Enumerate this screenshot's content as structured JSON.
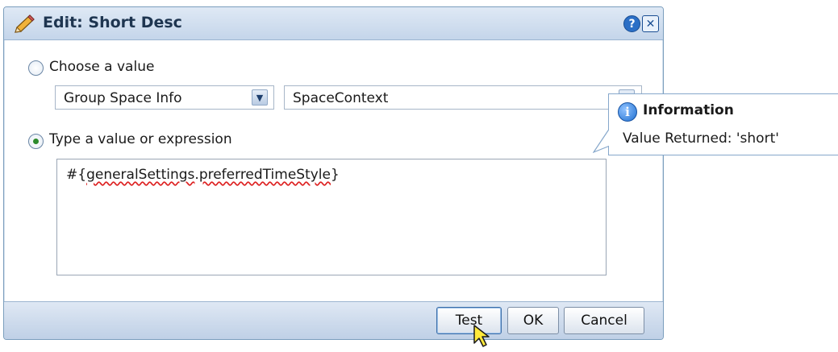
{
  "dialog": {
    "title": "Edit: Short Desc",
    "icons": {
      "title_icon": "pencil-icon",
      "help": "help-icon",
      "close": "close-icon"
    },
    "help_glyph": "?",
    "close_glyph": "✕"
  },
  "choose": {
    "label": "Choose a value",
    "selected": false,
    "select1_value": "Group Space Info",
    "select2_value": "SpaceContext"
  },
  "expression": {
    "label": "Type a value or expression",
    "selected": true,
    "prefix": "#{",
    "underlined": "generalSettings",
    "dot": ".",
    "underlined2": "preferredTimeStyle",
    "suffix": "}"
  },
  "buttons": {
    "test": "Test",
    "ok": "OK",
    "cancel": "Cancel"
  },
  "info_popup": {
    "icon_glyph": "i",
    "heading": "Information",
    "message": "Value Returned: 'short'"
  },
  "colors": {
    "accent": "#2b6fc6",
    "titlebar": "#c4d5ea",
    "radio_dot": "#2c8a2c"
  }
}
